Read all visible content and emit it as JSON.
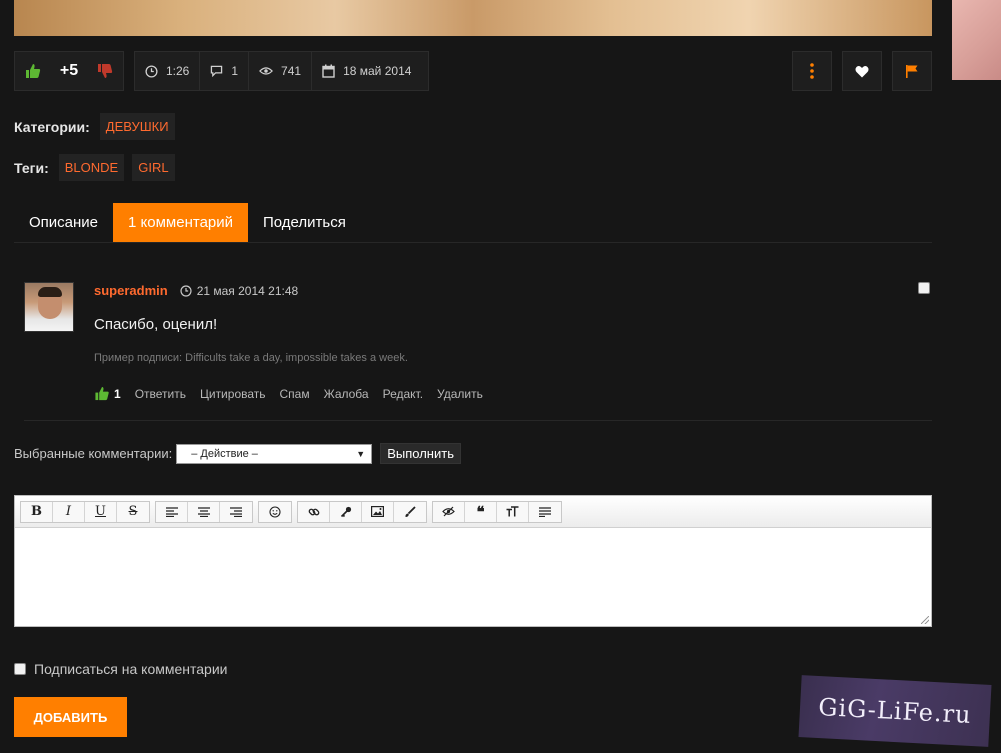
{
  "stats": {
    "score": "+5",
    "duration": "1:26",
    "comments": "1",
    "views": "741",
    "date": "18 май 2014"
  },
  "categories": {
    "label": "Категории:",
    "items": [
      "ДЕВУШКИ"
    ]
  },
  "tags": {
    "label": "Теги:",
    "items": [
      "BLONDE",
      "GIRL"
    ]
  },
  "tabs": [
    {
      "label": "Описание",
      "active": false
    },
    {
      "label": "1 комментарий",
      "active": true
    },
    {
      "label": "Поделиться",
      "active": false
    }
  ],
  "comment": {
    "author": "superadmin",
    "date": "21 мая 2014 21:48",
    "text": "Спасибо, оценил!",
    "signature": "Пример подписи: Difficults take a day, impossible takes a week.",
    "likes": "1",
    "actions": [
      "Ответить",
      "Цитировать",
      "Спам",
      "Жалоба",
      "Редакт.",
      "Удалить"
    ]
  },
  "selected": {
    "label": "Выбранные комментарии:",
    "select_value": "– Действие –",
    "execute_label": "Выполнить"
  },
  "editor": {
    "toolbar": [
      "B",
      "I",
      "U",
      "S"
    ]
  },
  "subscribe": {
    "label": "Подписаться на комментарии"
  },
  "submit_label": "ДОБАВИТЬ",
  "watermark": "GiG-LiFe.ru",
  "colors": {
    "accent": "#ff7f00",
    "link": "#ff6a2f",
    "like": "#5db833",
    "dislike": "#c0392b"
  }
}
